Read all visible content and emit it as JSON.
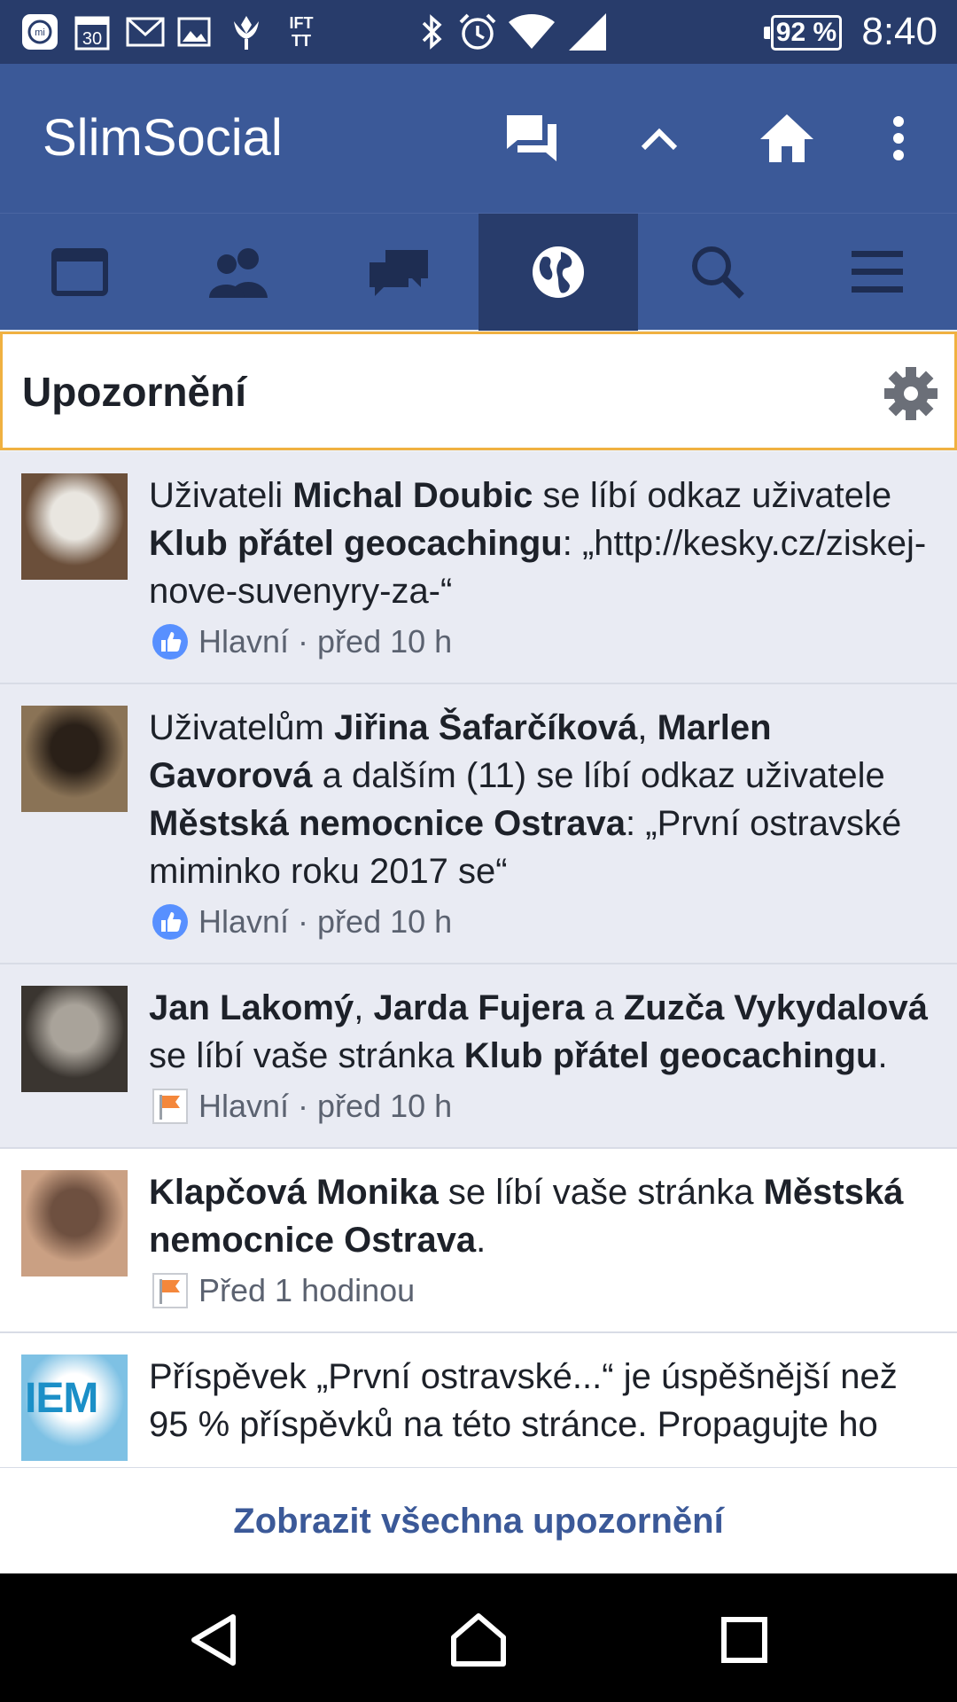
{
  "status_bar": {
    "time": "8:40",
    "battery": "92 %",
    "calendar_day": "30",
    "ifttt_label": "IFT TT",
    "icons": [
      "mi-icon",
      "calendar-icon",
      "gmail-icon",
      "image-icon",
      "tulip-icon",
      "ifttt-icon",
      "bluetooth-icon",
      "alarm-icon",
      "wifi-icon",
      "signal-icon",
      "battery-icon"
    ]
  },
  "app_bar": {
    "title": "SlimSocial",
    "actions": [
      "messages-icon",
      "scroll-up-icon",
      "home-icon",
      "more-vert-icon"
    ]
  },
  "tabs": [
    {
      "name": "news-feed-tab",
      "icon": "newsfeed-icon",
      "active": false
    },
    {
      "name": "friends-tab",
      "icon": "friends-icon",
      "active": false
    },
    {
      "name": "messages-tab",
      "icon": "chat-icon",
      "active": false
    },
    {
      "name": "notifications-tab",
      "icon": "globe-icon",
      "active": true
    },
    {
      "name": "search-tab",
      "icon": "search-icon",
      "active": false
    },
    {
      "name": "menu-tab",
      "icon": "hamburger-icon",
      "active": false
    }
  ],
  "header": {
    "title": "Upozornění",
    "settings_icon": "gear-icon"
  },
  "notifications": [
    {
      "parts": [
        {
          "t": "Uživateli ",
          "b": false
        },
        {
          "t": "Michal Doubic",
          "b": true
        },
        {
          "t": " se líbí odkaz uživatele ",
          "b": false
        },
        {
          "t": "Klub přátel geocachingu",
          "b": true
        },
        {
          "t": ": „http://kesky.cz/ziskej-nove-suvenyry-za-“",
          "b": false
        }
      ],
      "meta_icon": "like-icon",
      "meta": "Hlavní · před 10 h",
      "read": false,
      "avatar_colors": [
        "#6b4f3a",
        "#e9e6e0"
      ]
    },
    {
      "parts": [
        {
          "t": "Uživatelům ",
          "b": false
        },
        {
          "t": "Jiřina Šafarčíková",
          "b": true
        },
        {
          "t": ", ",
          "b": false
        },
        {
          "t": "Marlen Gavorová",
          "b": true
        },
        {
          "t": " a dalším (11) se líbí odkaz uživatele ",
          "b": false
        },
        {
          "t": "Městská nemocnice Ostrava",
          "b": true
        },
        {
          "t": ": „První ostravské miminko roku 2017 se“",
          "b": false
        }
      ],
      "meta_icon": "like-icon",
      "meta": "Hlavní · před 10 h",
      "read": false,
      "avatar_colors": [
        "#8a7356",
        "#2a2018"
      ]
    },
    {
      "parts": [
        {
          "t": "Jan Lakomý",
          "b": true
        },
        {
          "t": ", ",
          "b": false
        },
        {
          "t": "Jarda Fujera",
          "b": true
        },
        {
          "t": " a ",
          "b": false
        },
        {
          "t": "Zuzča Vykydalová",
          "b": true
        },
        {
          "t": " se líbí vaše stránka ",
          "b": false
        },
        {
          "t": "Klub přátel geocachingu",
          "b": true
        },
        {
          "t": ".",
          "b": false
        }
      ],
      "meta_icon": "page-flag-icon",
      "meta": "Hlavní · před 10 h",
      "read": false,
      "avatar_colors": [
        "#3a3530",
        "#a9a39a"
      ]
    },
    {
      "parts": [
        {
          "t": "Klapčová Monika",
          "b": true
        },
        {
          "t": " se líbí vaše stránka ",
          "b": false
        },
        {
          "t": "Městská nemocnice Ostrava",
          "b": true
        },
        {
          "t": ".",
          "b": false
        }
      ],
      "meta_icon": "page-flag-icon",
      "meta": "Před 1 hodinou",
      "read": true,
      "avatar_colors": [
        "#caa083",
        "#6e5040"
      ]
    },
    {
      "parts": [
        {
          "t": "Příspěvek „První ostravské...“ je úspěšnější než 95 % příspěvků na této stránce. Propagujte ho",
          "b": false
        }
      ],
      "meta_icon": "",
      "meta": "",
      "read": true,
      "avatar_colors": [
        "#7ec1e4",
        "#ffffff"
      ],
      "avatar_text": "IEM"
    }
  ],
  "footer": {
    "see_all": "Zobrazit všechna upozornění"
  },
  "nav_bar": [
    "back-icon",
    "home-nav-icon",
    "recents-icon"
  ],
  "colors": {
    "facebook_blue": "#3b5998",
    "dark_blue": "#283c6b",
    "header_border": "#f0b141",
    "unread_bg": "#e9ebf3"
  }
}
